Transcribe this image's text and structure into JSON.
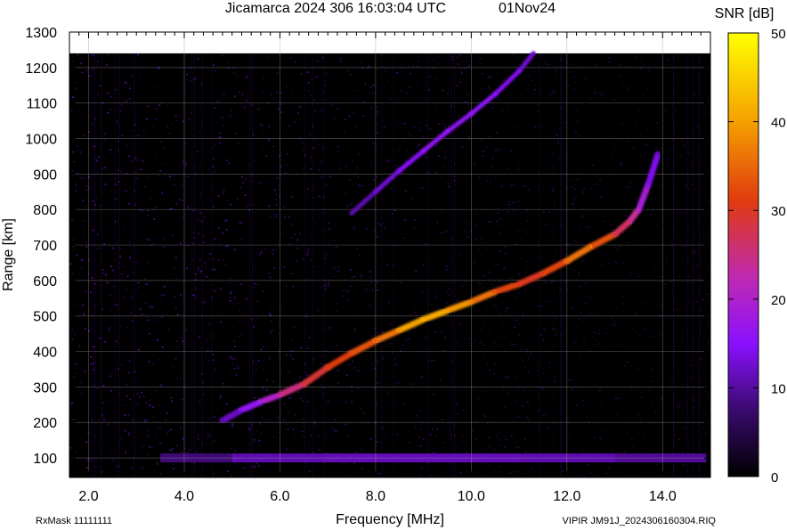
{
  "chart_data": {
    "type": "heatmap",
    "title": "Jicamarca 2024 306 16:03:04 UTC",
    "date_label": "01Nov24",
    "xlabel": "Frequency [MHz]",
    "ylabel": "Range [km]",
    "xlim": [
      1.6,
      15.0
    ],
    "ylim": [
      45,
      1300
    ],
    "x_ticks": [
      2.0,
      4.0,
      6.0,
      8.0,
      10.0,
      12.0,
      14.0
    ],
    "x_tick_labels": [
      "2.0",
      "4.0",
      "6.0",
      "8.0",
      "10.0",
      "12.0",
      "14.0"
    ],
    "y_ticks": [
      100,
      200,
      300,
      400,
      500,
      600,
      700,
      800,
      900,
      1000,
      1100,
      1200,
      1300
    ],
    "y_tick_labels": [
      "100",
      "200",
      "300",
      "400",
      "500",
      "600",
      "700",
      "800",
      "900",
      "1000",
      "1100",
      "1200",
      "1300"
    ],
    "grid": true,
    "data_ceiling_km": 1240,
    "colorbar": {
      "label": "SNR [dB]",
      "range": [
        0,
        50
      ],
      "ticks": [
        0,
        10,
        20,
        30,
        40,
        50
      ],
      "tick_labels": [
        "0",
        "10",
        "20",
        "30",
        "40",
        "50"
      ],
      "colors": [
        "#000000",
        "#3a0a6e",
        "#8a10ff",
        "#c02ab0",
        "#e03a10",
        "#f5a000",
        "#ffff00"
      ]
    },
    "series": [
      {
        "trace": "first-hop echo",
        "x": [
          4.8,
          5.2,
          5.6,
          6.0,
          6.5,
          7.0,
          7.5,
          8.0,
          8.5,
          9.0,
          9.5,
          10.0,
          10.5,
          11.0,
          11.5,
          12.0,
          12.5,
          13.0,
          13.3,
          13.5,
          13.7,
          13.9
        ],
        "y": [
          205,
          235,
          258,
          278,
          308,
          355,
          395,
          430,
          460,
          490,
          515,
          540,
          568,
          590,
          620,
          655,
          695,
          730,
          765,
          800,
          870,
          955
        ],
        "snr": [
          10,
          14,
          18,
          22,
          28,
          30,
          32,
          34,
          38,
          42,
          40,
          38,
          34,
          30,
          30,
          34,
          38,
          28,
          26,
          22,
          16,
          12
        ]
      },
      {
        "trace": "second-hop echo",
        "x": [
          7.5,
          8.0,
          8.5,
          9.0,
          9.5,
          10.0,
          10.5,
          11.0,
          11.3
        ],
        "y": [
          790,
          850,
          910,
          965,
          1020,
          1070,
          1125,
          1190,
          1240
        ],
        "snr": [
          10,
          12,
          14,
          16,
          16,
          16,
          15,
          14,
          12
        ]
      },
      {
        "trace": "low-range band",
        "x": [
          3.5,
          5.0,
          7.0,
          9.0,
          11.0,
          13.0,
          14.9
        ],
        "y": [
          100,
          100,
          100,
          100,
          100,
          100,
          100
        ],
        "snr": [
          6,
          12,
          13,
          13,
          13,
          12,
          10
        ]
      }
    ]
  },
  "footer": {
    "rx_mask": "RxMask 11111111",
    "file_info": "VIPIR  JM91J_2024306160304.RIQ"
  }
}
